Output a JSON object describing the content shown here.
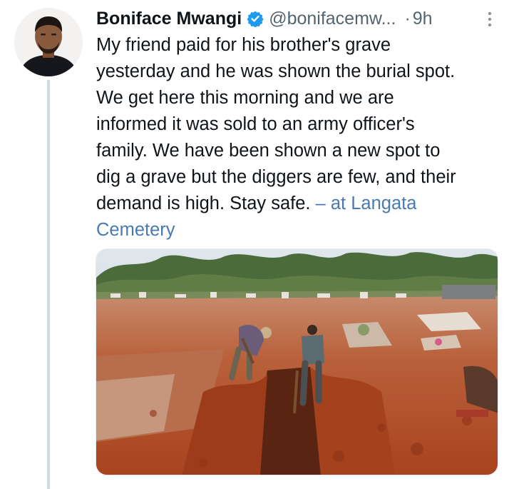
{
  "tweet": {
    "author": {
      "display_name": "Boniface Mwangi",
      "handle": "@bonifacemw...",
      "verified": true
    },
    "separator": "·",
    "time": "9h",
    "text_lines": [
      "My friend paid for his brother's grave",
      "yesterday and he was shown the burial spot.",
      "We get here this morning and we are",
      "informed it was sold to an army officer's",
      "family. We have been shown a new spot to",
      "dig a grave but the diggers are few, and their",
      "demand is high. Stay safe. "
    ],
    "location_text": "– at Langata",
    "location_text_2": "Cemetery",
    "media_alt": "Men digging a grave in red soil at a cemetery",
    "icons": {
      "more": "more-vertical-icon",
      "verified": "verified-badge-icon"
    },
    "colors": {
      "accent": "#1d9bf0",
      "location_link": "#4a7ab0",
      "secondary_text": "#536471",
      "thread_line": "#cfd9de",
      "soil": "#b4502a"
    }
  }
}
